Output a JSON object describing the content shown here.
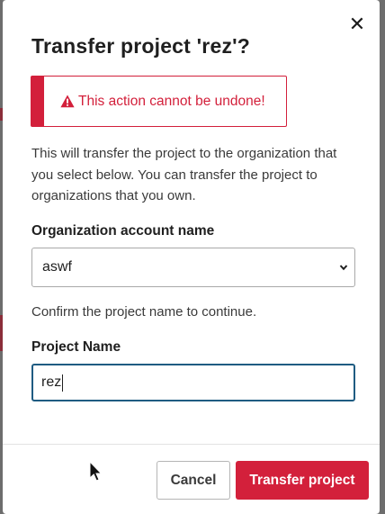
{
  "dialog": {
    "title": "Transfer project 'rez'?",
    "close_icon": "close-icon",
    "close_glyph": "✕"
  },
  "alert": {
    "icon": "warning-icon",
    "text": "This action cannot be undone!",
    "color": "#d3203b"
  },
  "description": "This will transfer the project to the organization that you select below. You can transfer the project to organizations that you own.",
  "organization": {
    "label": "Organization account name",
    "selected_value": "aswf"
  },
  "confirm_text": "Confirm the project name to continue.",
  "project_name": {
    "label": "Project Name",
    "value": "rez"
  },
  "footer": {
    "cancel_label": "Cancel",
    "transfer_label": "Transfer project"
  },
  "colors": {
    "accent": "#d3203b",
    "focus_border": "#1f5c82"
  }
}
